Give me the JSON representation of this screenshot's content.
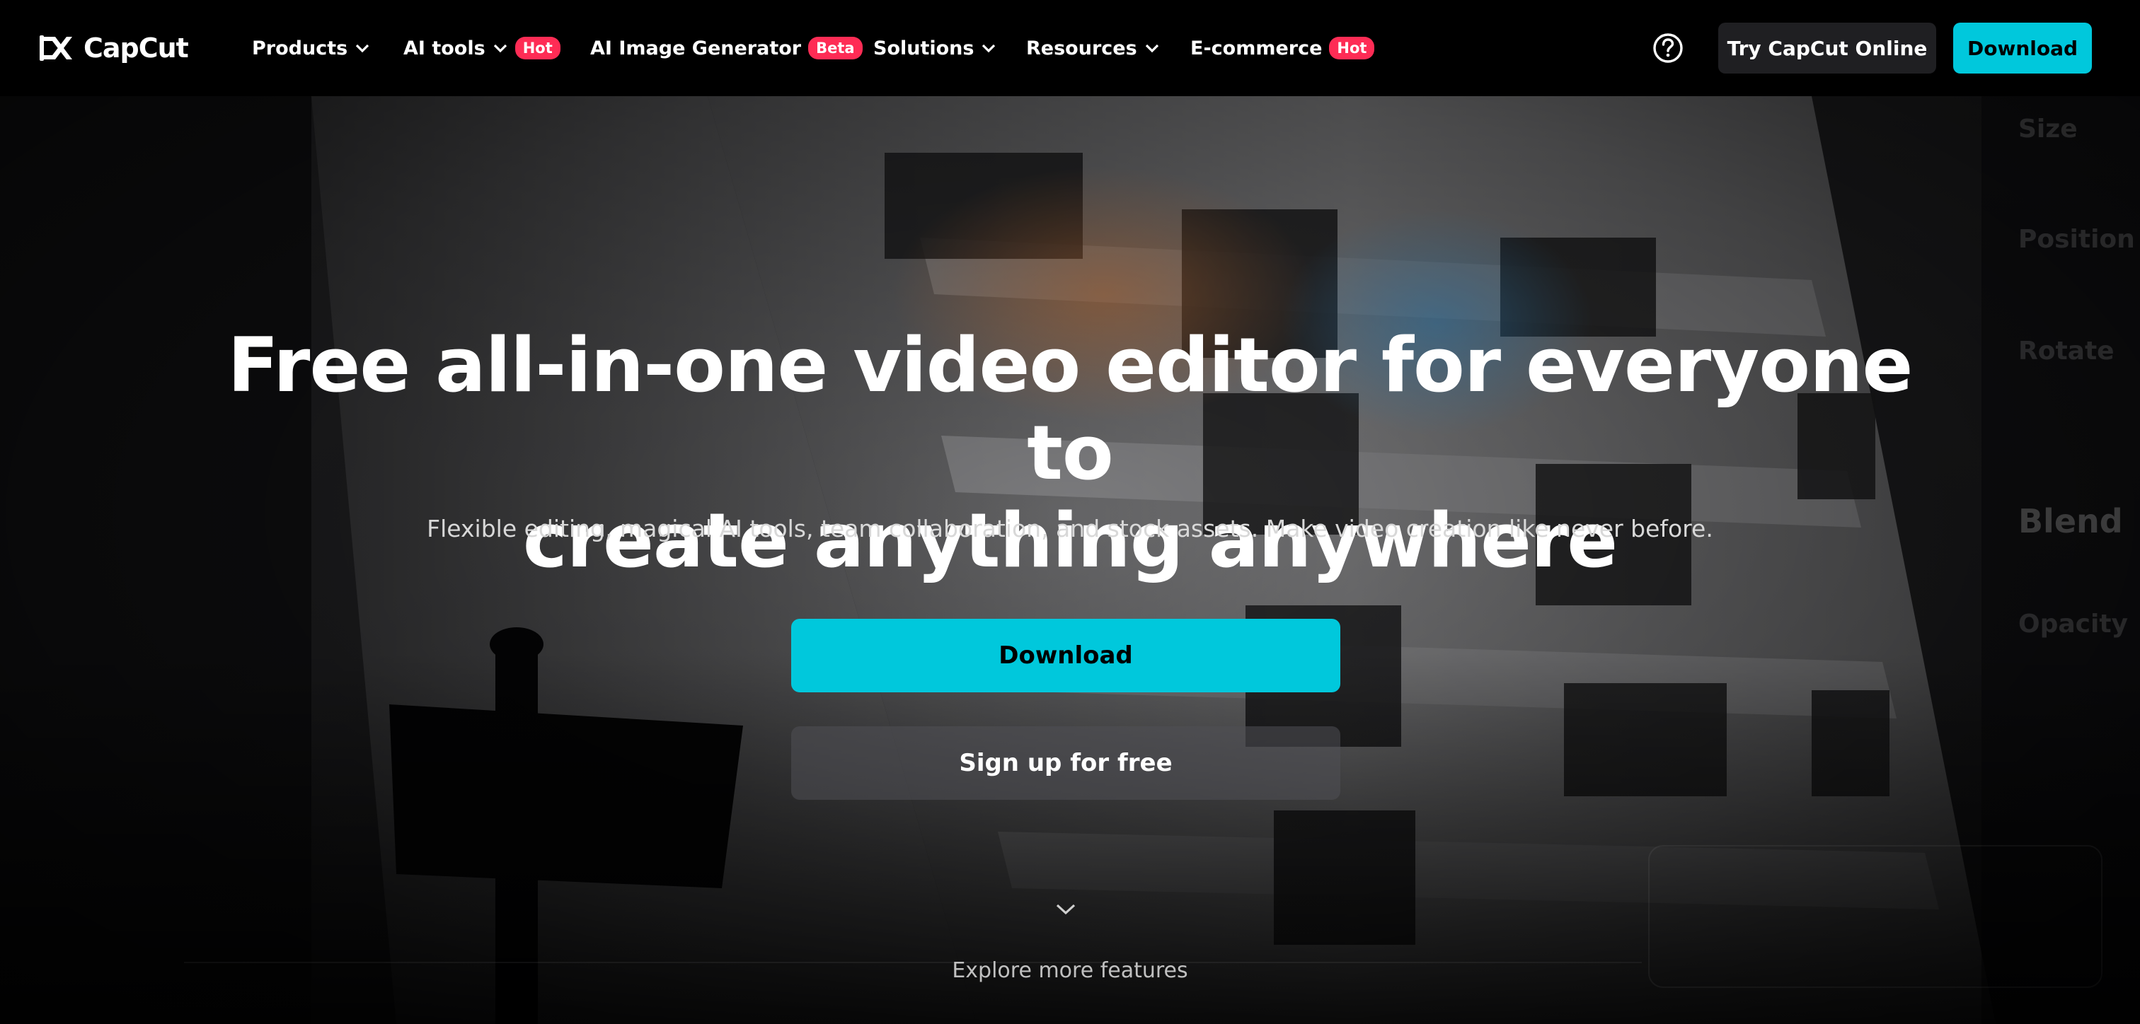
{
  "nav": {
    "brand": "CapCut",
    "items": [
      {
        "label": "Products",
        "chevron": true,
        "badge": ""
      },
      {
        "label": "AI tools",
        "chevron": true,
        "badge": "Hot"
      },
      {
        "label": "AI Image Generator",
        "chevron": false,
        "badge": "Beta"
      },
      {
        "label": "Solutions",
        "chevron": true,
        "badge": ""
      },
      {
        "label": "Resources",
        "chevron": true,
        "badge": ""
      },
      {
        "label": "E-commerce",
        "chevron": false,
        "badge": "Hot"
      }
    ],
    "try_online_label": "Try CapCut Online",
    "download_label": "Download"
  },
  "hero": {
    "headline_line1": "Free all-in-one video editor for everyone to",
    "headline_line2": "create anything anywhere",
    "subheadline": "Flexible editing, magical AI tools, team collaboration, and stock assets. Make video creation like never before.",
    "download_label": "Download",
    "signup_label": "Sign up for free",
    "explore_label": "Explore more features"
  },
  "background_editor": {
    "panel_labels": [
      "Size",
      "Position",
      "Rotate",
      "Blend",
      "Opacity"
    ]
  },
  "colors": {
    "accent": "#00c8dc",
    "badge": "#fe2c55",
    "nav_bg": "#000000",
    "secondary_button": "#1f1f22"
  },
  "icons": [
    "capcut-logo-icon",
    "chevron-down-icon",
    "help-icon"
  ]
}
